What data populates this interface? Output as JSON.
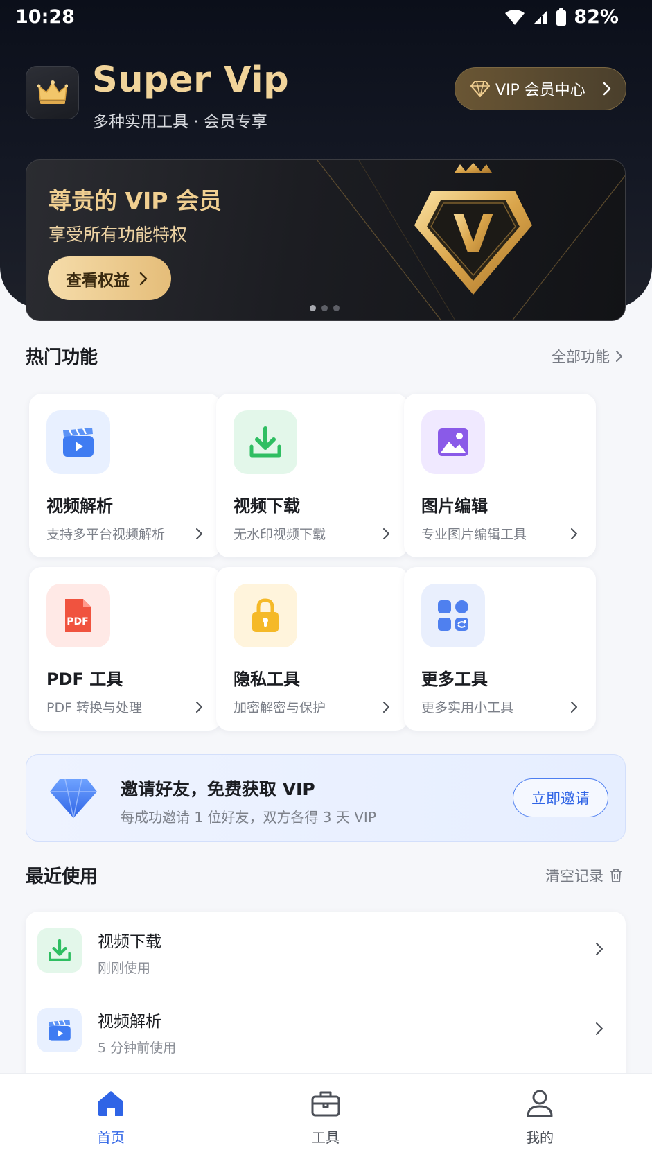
{
  "status_bar": {
    "time": "10:28",
    "battery": "82%"
  },
  "header": {
    "brand_title": "Super Vip",
    "brand_subtitle": "多种实用工具 · 会员专享",
    "vip_center_label": "VIP 会员中心"
  },
  "banner": {
    "title": "尊贵的 VIP 会员",
    "subtitle": "享受所有功能特权",
    "button_label": "查看权益",
    "emblem_letter": "V",
    "page_count": 3,
    "active_page": 1
  },
  "hot": {
    "title": "热门功能",
    "link_label": "全部功能",
    "items": [
      {
        "title": "视频解析",
        "desc": "支持多平台视频解析",
        "icon": "video-clapper-icon",
        "color": "#3f7cf2",
        "bg": "#e8f0ff"
      },
      {
        "title": "视频下载",
        "desc": "无水印视频下载",
        "icon": "download-icon",
        "color": "#2fbe62",
        "bg": "#e3f7ea"
      },
      {
        "title": "图片编辑",
        "desc": "专业图片编辑工具",
        "icon": "image-icon",
        "color": "#8a5ae8",
        "bg": "#f0e9ff"
      },
      {
        "title": "PDF 工具",
        "desc": "PDF 转换与处理",
        "icon": "pdf-file-icon",
        "color": "#f0533f",
        "bg": "#ffe9e6",
        "icon_text": "PDF"
      },
      {
        "title": "隐私工具",
        "desc": "加密解密与保护",
        "icon": "lock-icon",
        "color": "#f5b928",
        "bg": "#fff4dc"
      },
      {
        "title": "更多工具",
        "desc": "更多实用小工具",
        "icon": "apps-grid-icon",
        "color": "#4f80ef",
        "bg": "#e9effd"
      }
    ]
  },
  "invite": {
    "title": "邀请好友，免费获取 VIP",
    "subtitle": "每成功邀请 1 位好友，双方各得 3 天 VIP",
    "button_label": "立即邀请"
  },
  "recent": {
    "title": "最近使用",
    "clear_label": "清空记录",
    "items": [
      {
        "title": "视频下载",
        "time": "刚刚使用",
        "icon": "download-icon"
      },
      {
        "title": "视频解析",
        "time": "5 分钟前使用",
        "icon": "video-clapper-icon"
      }
    ]
  },
  "tabbar": {
    "items": [
      {
        "label": "首页",
        "icon": "home-icon",
        "active": true
      },
      {
        "label": "工具",
        "icon": "toolbox-icon",
        "active": false
      },
      {
        "label": "我的",
        "icon": "user-icon",
        "active": false
      }
    ]
  },
  "colors": {
    "accent_blue": "#2f64e6",
    "gold": "#f0cf91",
    "dark_bg": "#0b0f1a"
  }
}
